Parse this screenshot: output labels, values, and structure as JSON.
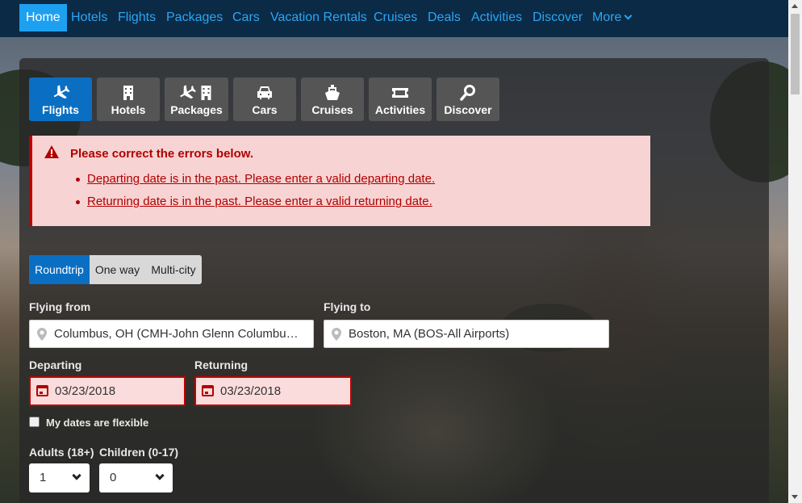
{
  "topnav": {
    "items": [
      "Home",
      "Hotels",
      "Flights",
      "Packages",
      "Cars",
      "Vacation Rentals",
      "Cruises",
      "Deals",
      "Activities",
      "Discover",
      "More"
    ]
  },
  "tabs": [
    "Flights",
    "Hotels",
    "Packages",
    "Cars",
    "Cruises",
    "Activities",
    "Discover"
  ],
  "errors": {
    "title": "Please correct the errors below.",
    "items": [
      "Departing date is in the past. Please enter a valid departing date.",
      "Returning date is in the past. Please enter a valid returning date."
    ]
  },
  "trip_type": {
    "options": [
      "Roundtrip",
      "One way",
      "Multi-city"
    ],
    "selected": "Roundtrip"
  },
  "form": {
    "from_label": "Flying from",
    "from_value": "Columbus, OH (CMH-John Glenn Columbus International)",
    "to_label": "Flying to",
    "to_value": "Boston, MA (BOS-All Airports)",
    "departing_label": "Departing",
    "departing_value": "03/23/2018",
    "returning_label": "Returning",
    "returning_value": "03/23/2018",
    "flexible_label": "My dates are flexible",
    "adults_label": "Adults (18+)",
    "adults_value": "1",
    "children_label": "Children (0-17)",
    "children_value": "0"
  },
  "colors": {
    "accent": "#0a6fc2",
    "nav_bg": "#0b2a45",
    "nav_link": "#2ba6f5",
    "error": "#b00000",
    "error_bg": "#f8d3d3"
  }
}
